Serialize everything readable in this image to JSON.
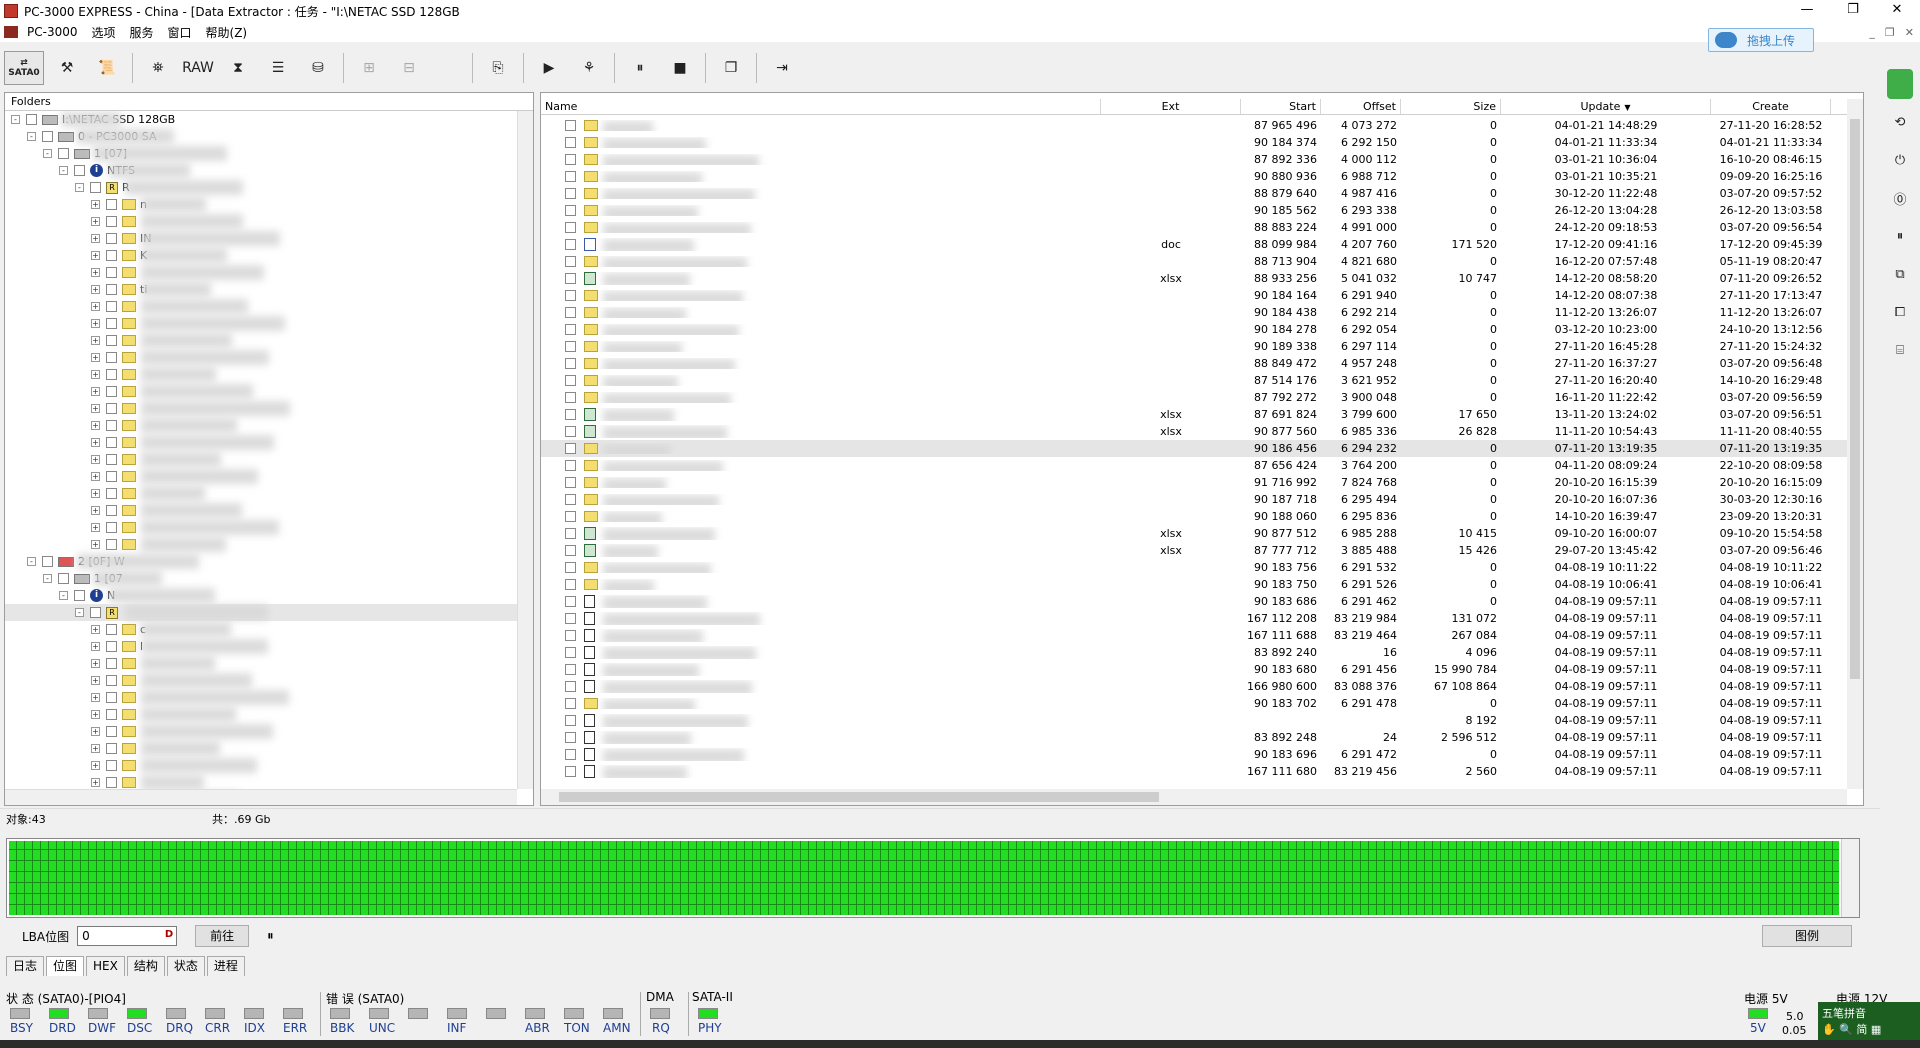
{
  "titlebar": {
    "title": "PC-3000 EXPRESS - China - [Data Extractor : 任务 - \"I:\\NETAC SSD 128GB",
    "min": "—",
    "max": "❐",
    "close": "✕"
  },
  "menu": [
    "PC-3000",
    "选项",
    "服务",
    "窗口",
    "帮助(Z)"
  ],
  "upload_button": "拖拽上传",
  "toolbar": {
    "sata": "SATA0",
    "raw": "RAW"
  },
  "tree": {
    "header": "Folders",
    "nodes": [
      {
        "indent": 0,
        "label": "I:\\NETAC SSD 128GB",
        "exp": "-",
        "icon": "drive"
      },
      {
        "indent": 1,
        "label": "0 - PC3000 SA",
        "exp": "-",
        "icon": "drive"
      },
      {
        "indent": 2,
        "label": "1 [07]",
        "exp": "-",
        "icon": "drive"
      },
      {
        "indent": 3,
        "label": "NTFS",
        "exp": "-",
        "icon": "info"
      },
      {
        "indent": 4,
        "label": "R",
        "exp": "-",
        "icon": "root"
      },
      {
        "indent": 5,
        "label": "n",
        "exp": "+",
        "icon": "folder"
      },
      {
        "indent": 5,
        "label": "",
        "exp": "+",
        "icon": "folder"
      },
      {
        "indent": 5,
        "label": "IN",
        "exp": "+",
        "icon": "folder"
      },
      {
        "indent": 5,
        "label": "K",
        "exp": "+",
        "icon": "folder"
      },
      {
        "indent": 5,
        "label": "",
        "exp": "+",
        "icon": "folder"
      },
      {
        "indent": 5,
        "label": "ti",
        "exp": "+",
        "icon": "folder"
      },
      {
        "indent": 5,
        "label": "",
        "exp": "+",
        "icon": "folder"
      },
      {
        "indent": 5,
        "label": "",
        "exp": "+",
        "icon": "folder"
      },
      {
        "indent": 5,
        "label": "",
        "exp": "+",
        "icon": "folder"
      },
      {
        "indent": 5,
        "label": "",
        "exp": "+",
        "icon": "folder"
      },
      {
        "indent": 5,
        "label": "",
        "exp": "+",
        "icon": "folder"
      },
      {
        "indent": 5,
        "label": "",
        "exp": "+",
        "icon": "folder"
      },
      {
        "indent": 5,
        "label": "",
        "exp": "+",
        "icon": "folder"
      },
      {
        "indent": 5,
        "label": "",
        "exp": "+",
        "icon": "folder"
      },
      {
        "indent": 5,
        "label": "",
        "exp": "+",
        "icon": "folder"
      },
      {
        "indent": 5,
        "label": "",
        "exp": "+",
        "icon": "folder"
      },
      {
        "indent": 5,
        "label": "",
        "exp": "+",
        "icon": "folder"
      },
      {
        "indent": 5,
        "label": "",
        "exp": "+",
        "icon": "folder"
      },
      {
        "indent": 5,
        "label": "",
        "exp": "+",
        "icon": "folder"
      },
      {
        "indent": 5,
        "label": "",
        "exp": "+",
        "icon": "folder"
      },
      {
        "indent": 5,
        "label": "",
        "exp": "+",
        "icon": "folder"
      },
      {
        "indent": 1,
        "label": "2 [0F] W",
        "exp": "-",
        "icon": "drive-red"
      },
      {
        "indent": 2,
        "label": "1 [07",
        "exp": "-",
        "icon": "drive"
      },
      {
        "indent": 3,
        "label": "N",
        "exp": "-",
        "icon": "info"
      },
      {
        "indent": 4,
        "label": "",
        "exp": "-",
        "icon": "root",
        "selected": true
      },
      {
        "indent": 5,
        "label": "c",
        "exp": "+",
        "icon": "folder"
      },
      {
        "indent": 5,
        "label": "l",
        "exp": "+",
        "icon": "folder"
      },
      {
        "indent": 5,
        "label": "",
        "exp": "+",
        "icon": "folder"
      },
      {
        "indent": 5,
        "label": "",
        "exp": "+",
        "icon": "folder"
      },
      {
        "indent": 5,
        "label": "",
        "exp": "+",
        "icon": "folder"
      },
      {
        "indent": 5,
        "label": "",
        "exp": "+",
        "icon": "folder"
      },
      {
        "indent": 5,
        "label": "",
        "exp": "+",
        "icon": "folder"
      },
      {
        "indent": 5,
        "label": "",
        "exp": "+",
        "icon": "folder"
      },
      {
        "indent": 5,
        "label": "",
        "exp": "+",
        "icon": "folder"
      },
      {
        "indent": 5,
        "label": "",
        "exp": "+",
        "icon": "folder"
      },
      {
        "indent": 5,
        "label": "",
        "exp": "+",
        "icon": "folder"
      },
      {
        "indent": 5,
        "label": "",
        "exp": "+",
        "icon": "folder"
      },
      {
        "indent": 5,
        "label": "",
        "exp": "+",
        "icon": "folder"
      },
      {
        "indent": 5,
        "label": "",
        "exp": "+",
        "icon": "folder"
      }
    ]
  },
  "list": {
    "columns": [
      "Name",
      "Ext",
      "Start",
      "Offset",
      "Size",
      "Update",
      "Create"
    ],
    "sort_indicator": "▼",
    "rows": [
      {
        "icon": "folder",
        "name": "",
        "ext": "",
        "start": "87 965 496",
        "offset": "4 073 272",
        "size": "0",
        "update": "04-01-21 14:48:29",
        "create": "27-11-20 16:28:52"
      },
      {
        "icon": "folder",
        "name": "",
        "ext": "",
        "start": "90 184 374",
        "offset": "6 292 150",
        "size": "0",
        "update": "04-01-21 11:33:34",
        "create": "04-01-21 11:33:34"
      },
      {
        "icon": "folder",
        "name": "",
        "ext": "",
        "start": "87 892 336",
        "offset": "4 000 112",
        "size": "0",
        "update": "03-01-21 10:36:04",
        "create": "16-10-20 08:46:15"
      },
      {
        "icon": "folder",
        "name": "",
        "ext": "",
        "start": "90 880 936",
        "offset": "6 988 712",
        "size": "0",
        "update": "03-01-21 10:35:21",
        "create": "09-09-20 16:25:16"
      },
      {
        "icon": "folder",
        "name": "",
        "ext": "",
        "start": "88 879 640",
        "offset": "4 987 416",
        "size": "0",
        "update": "30-12-20 11:22:48",
        "create": "03-07-20 09:57:52"
      },
      {
        "icon": "folder",
        "name": "",
        "ext": "",
        "start": "90 185 562",
        "offset": "6 293 338",
        "size": "0",
        "update": "26-12-20 13:04:28",
        "create": "26-12-20 13:03:58"
      },
      {
        "icon": "folder",
        "name": "",
        "ext": "",
        "start": "88 883 224",
        "offset": "4 991 000",
        "size": "0",
        "update": "24-12-20 09:18:53",
        "create": "03-07-20 09:56:54"
      },
      {
        "icon": "doc",
        "name": "",
        "ext": "doc",
        "start": "88 099 984",
        "offset": "4 207 760",
        "size": "171 520",
        "update": "17-12-20 09:41:16",
        "create": "17-12-20 09:45:39"
      },
      {
        "icon": "folder",
        "name": "",
        "ext": "",
        "start": "88 713 904",
        "offset": "4 821 680",
        "size": "0",
        "update": "16-12-20 07:57:48",
        "create": "05-11-19 08:20:47"
      },
      {
        "icon": "xls",
        "name": "",
        "ext": "xlsx",
        "start": "88 933 256",
        "offset": "5 041 032",
        "size": "10 747",
        "update": "14-12-20 08:58:20",
        "create": "07-11-20 09:26:52"
      },
      {
        "icon": "folder",
        "name": "",
        "ext": "",
        "start": "90 184 164",
        "offset": "6 291 940",
        "size": "0",
        "update": "14-12-20 08:07:38",
        "create": "27-11-20 17:13:47"
      },
      {
        "icon": "folder",
        "name": "",
        "ext": "",
        "start": "90 184 438",
        "offset": "6 292 214",
        "size": "0",
        "update": "11-12-20 13:26:07",
        "create": "11-12-20 13:26:07"
      },
      {
        "icon": "folder",
        "name": "",
        "ext": "",
        "start": "90 184 278",
        "offset": "6 292 054",
        "size": "0",
        "update": "03-12-20 10:23:00",
        "create": "24-10-20 13:12:56"
      },
      {
        "icon": "folder",
        "name": "",
        "ext": "",
        "start": "90 189 338",
        "offset": "6 297 114",
        "size": "0",
        "update": "27-11-20 16:45:28",
        "create": "27-11-20 15:24:32"
      },
      {
        "icon": "folder",
        "name": "",
        "ext": "",
        "start": "88 849 472",
        "offset": "4 957 248",
        "size": "0",
        "update": "27-11-20 16:37:27",
        "create": "03-07-20 09:56:48"
      },
      {
        "icon": "folder",
        "name": "",
        "ext": "",
        "start": "87 514 176",
        "offset": "3 621 952",
        "size": "0",
        "update": "27-11-20 16:20:40",
        "create": "14-10-20 16:29:48"
      },
      {
        "icon": "folder",
        "name": "",
        "ext": "",
        "start": "87 792 272",
        "offset": "3 900 048",
        "size": "0",
        "update": "16-11-20 11:22:42",
        "create": "03-07-20 09:56:59"
      },
      {
        "icon": "xls",
        "name": "",
        "ext": "xlsx",
        "start": "87 691 824",
        "offset": "3 799 600",
        "size": "17 650",
        "update": "13-11-20 13:24:02",
        "create": "03-07-20 09:56:51"
      },
      {
        "icon": "xls",
        "name": "",
        "ext": "xlsx",
        "start": "90 877 560",
        "offset": "6 985 336",
        "size": "26 828",
        "update": "11-11-20 10:54:43",
        "create": "11-11-20 08:40:55"
      },
      {
        "icon": "folder",
        "name": "",
        "ext": "",
        "start": "90 186 456",
        "offset": "6 294 232",
        "size": "0",
        "update": "07-11-20 13:19:35",
        "create": "07-11-20 13:19:35",
        "selected": true
      },
      {
        "icon": "folder",
        "name": "",
        "ext": "",
        "start": "87 656 424",
        "offset": "3 764 200",
        "size": "0",
        "update": "04-11-20 08:09:24",
        "create": "22-10-20 08:09:58"
      },
      {
        "icon": "folder",
        "name": "",
        "ext": "",
        "start": "91 716 992",
        "offset": "7 824 768",
        "size": "0",
        "update": "20-10-20 16:15:39",
        "create": "20-10-20 16:15:09"
      },
      {
        "icon": "folder",
        "name": "",
        "ext": "",
        "start": "90 187 718",
        "offset": "6 295 494",
        "size": "0",
        "update": "20-10-20 16:07:36",
        "create": "30-03-20 12:30:16"
      },
      {
        "icon": "folder",
        "name": "",
        "ext": "",
        "start": "90 188 060",
        "offset": "6 295 836",
        "size": "0",
        "update": "14-10-20 16:39:47",
        "create": "23-09-20 13:20:31"
      },
      {
        "icon": "xls",
        "name": "",
        "ext": "xlsx",
        "start": "90 877 512",
        "offset": "6 985 288",
        "size": "10 415",
        "update": "09-10-20 16:00:07",
        "create": "09-10-20 15:54:58"
      },
      {
        "icon": "xls",
        "name": "",
        "ext": "xlsx",
        "start": "87 777 712",
        "offset": "3 885 488",
        "size": "15 426",
        "update": "29-07-20 13:45:42",
        "create": "03-07-20 09:56:46"
      },
      {
        "icon": "folder",
        "name": "",
        "ext": "",
        "start": "90 183 756",
        "offset": "6 291 532",
        "size": "0",
        "update": "04-08-19 10:11:22",
        "create": "04-08-19 10:11:22"
      },
      {
        "icon": "folder",
        "name": "",
        "ext": "",
        "start": "90 183 750",
        "offset": "6 291 526",
        "size": "0",
        "update": "04-08-19 10:06:41",
        "create": "04-08-19 10:06:41"
      },
      {
        "icon": "bin",
        "name": "",
        "ext": "",
        "start": "90 183 686",
        "offset": "6 291 462",
        "size": "0",
        "update": "04-08-19 09:57:11",
        "create": "04-08-19 09:57:11"
      },
      {
        "icon": "bin",
        "name": "",
        "ext": "",
        "start": "167 112 208",
        "offset": "83 219 984",
        "size": "131 072",
        "update": "04-08-19 09:57:11",
        "create": "04-08-19 09:57:11"
      },
      {
        "icon": "bin",
        "name": "",
        "ext": "",
        "start": "167 111 688",
        "offset": "83 219 464",
        "size": "267 084",
        "update": "04-08-19 09:57:11",
        "create": "04-08-19 09:57:11"
      },
      {
        "icon": "bin",
        "name": "",
        "ext": "",
        "start": "83 892 240",
        "offset": "16",
        "size": "4 096",
        "update": "04-08-19 09:57:11",
        "create": "04-08-19 09:57:11"
      },
      {
        "icon": "bin",
        "name": "",
        "ext": "",
        "start": "90 183 680",
        "offset": "6 291 456",
        "size": "15 990 784",
        "update": "04-08-19 09:57:11",
        "create": "04-08-19 09:57:11"
      },
      {
        "icon": "bin",
        "name": "",
        "ext": "",
        "start": "166 980 600",
        "offset": "83 088 376",
        "size": "67 108 864",
        "update": "04-08-19 09:57:11",
        "create": "04-08-19 09:57:11"
      },
      {
        "icon": "folder",
        "name": "",
        "ext": "",
        "start": "90 183 702",
        "offset": "6 291 478",
        "size": "0",
        "update": "04-08-19 09:57:11",
        "create": "04-08-19 09:57:11"
      },
      {
        "icon": "bin",
        "name": "",
        "ext": "",
        "start": "",
        "offset": "",
        "size": "8 192",
        "update": "04-08-19 09:57:11",
        "create": "04-08-19 09:57:11"
      },
      {
        "icon": "bin",
        "name": "",
        "ext": "",
        "start": "83 892 248",
        "offset": "24",
        "size": "2 596 512",
        "update": "04-08-19 09:57:11",
        "create": "04-08-19 09:57:11"
      },
      {
        "icon": "bin",
        "name": "",
        "ext": "",
        "start": "90 183 696",
        "offset": "6 291 472",
        "size": "0",
        "update": "04-08-19 09:57:11",
        "create": "04-08-19 09:57:11"
      },
      {
        "icon": "bin",
        "name": "",
        "ext": "",
        "start": "167 111 680",
        "offset": "83 219 456",
        "size": "2 560",
        "update": "04-08-19 09:57:11",
        "create": "04-08-19 09:57:11"
      }
    ]
  },
  "status": {
    "objects": "对象:43",
    "total": "共：.69 Gb"
  },
  "lba": {
    "label": "LBA位图",
    "value": "0",
    "unit": "D",
    "go_button": "前往",
    "pause": "⏸",
    "legend_button": "图例"
  },
  "tabs": [
    "日志",
    "位图",
    "HEX",
    "结构",
    "状态",
    "进程"
  ],
  "active_tab": "位图",
  "indicators": {
    "status_group": {
      "title": "状 态 (SATA0)-[PIO4]",
      "leds": [
        {
          "l": "BSY",
          "on": false
        },
        {
          "l": "DRD",
          "on": true
        },
        {
          "l": "DWF",
          "on": false
        },
        {
          "l": "DSC",
          "on": true
        },
        {
          "l": "DRQ",
          "on": false
        },
        {
          "l": "CRR",
          "on": false
        },
        {
          "l": "IDX",
          "on": false
        },
        {
          "l": "ERR",
          "on": false
        }
      ]
    },
    "error_group": {
      "title": "错 误 (SATA0)",
      "leds": [
        {
          "l": "BBK",
          "on": false
        },
        {
          "l": "UNC",
          "on": false
        },
        {
          "l": "",
          "on": false
        },
        {
          "l": "INF",
          "on": false
        },
        {
          "l": "",
          "on": false
        },
        {
          "l": "ABR",
          "on": false
        },
        {
          "l": "TON",
          "on": false
        },
        {
          "l": "AMN",
          "on": false
        }
      ]
    },
    "dma": {
      "title": "DMA",
      "led": "RQ",
      "on": false
    },
    "sata": {
      "title": "SATA-II",
      "led": "PHY",
      "on": true
    },
    "power5": {
      "title": "电源 5V",
      "led": "5V",
      "on": true,
      "v1": "5.0",
      "v2": "0.05"
    },
    "power12": {
      "title": "电源 12V"
    }
  },
  "ime": {
    "label": "五笔拼音",
    "sub": "✋ 🔍 简 ▦"
  },
  "colors": {
    "led_on": "#22dd22",
    "led_off": "#b5b5b5",
    "accent": "#1f3f91"
  }
}
